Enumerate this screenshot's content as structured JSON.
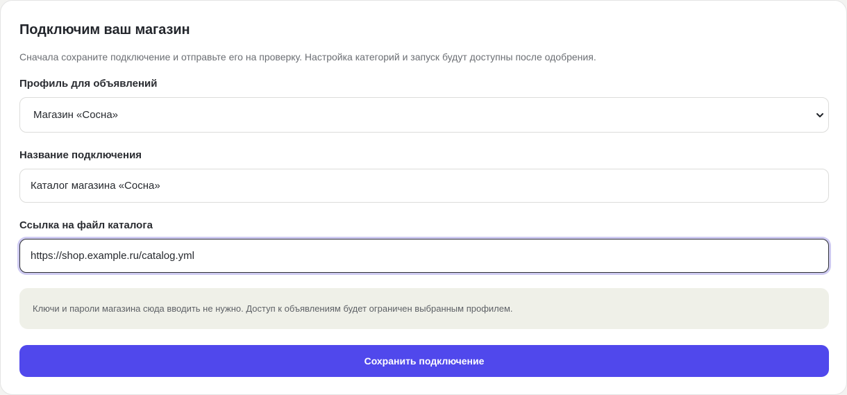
{
  "form": {
    "title": "Подключим ваш магазин",
    "subtitle": "Сначала сохраните подключение и отправьте его на проверку. Настройка категорий и запуск будут доступны после одобрения.",
    "profile": {
      "label": "Профиль для объявлений",
      "selected_value": "Магазин «Сосна»",
      "icon": "chevron-down-icon"
    },
    "connection_name": {
      "label": "Название подключения",
      "value": "Каталог магазина «Сосна»"
    },
    "catalog_url": {
      "label": "Ссылка на файл каталога",
      "value": "https://shop.example.ru/catalog.yml",
      "focused": true
    },
    "notice": "Ключи и пароли магазина сюда вводить не нужно. Доступ к объявлениям будет ограничен выбранным профилем.",
    "submit_label": "Сохранить подключение"
  },
  "colors": {
    "accent": "#5048ec",
    "focus_ring": "#cfcbf2",
    "notice_bg": "#eff0e8"
  }
}
